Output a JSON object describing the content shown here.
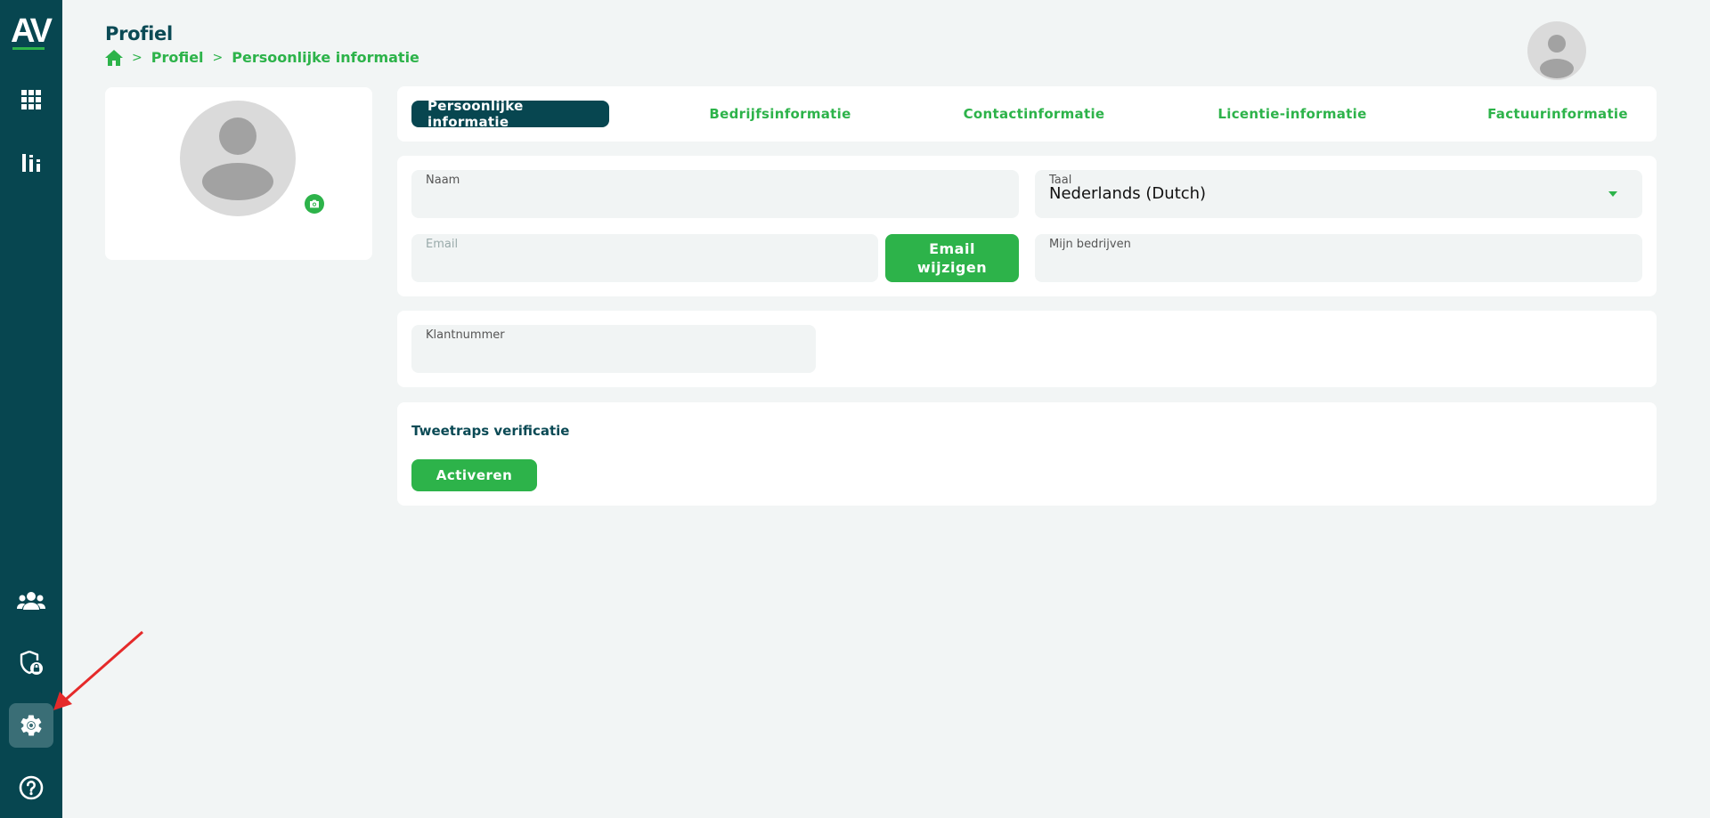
{
  "brand": {
    "logo_text": "AV",
    "accent": "#2db34a",
    "dark": "#074650"
  },
  "sidebar": {
    "items": [
      {
        "name": "apps-grid-icon"
      },
      {
        "name": "bar-chart-icon"
      },
      {
        "name": "users-group-icon"
      },
      {
        "name": "shield-lock-icon"
      },
      {
        "name": "gear-icon",
        "active": true
      },
      {
        "name": "help-icon"
      }
    ]
  },
  "header": {
    "title": "Profiel",
    "breadcrumb": {
      "separator": ">",
      "items": [
        "Profiel",
        "Persoonlijke informatie"
      ]
    }
  },
  "tabs": [
    {
      "label": "Persoonlijke informatie",
      "active": true
    },
    {
      "label": "Bedrijfsinformatie"
    },
    {
      "label": "Contactinformatie"
    },
    {
      "label": "Licentie-informatie"
    },
    {
      "label": "Factuurinformatie"
    }
  ],
  "form": {
    "name_label": "Naam",
    "name_value": "",
    "language_label": "Taal",
    "language_value": "Nederlands (Dutch)",
    "email_label": "Email",
    "email_value": "",
    "email_button": "Email wijzigen",
    "companies_label": "Mijn bedrijven",
    "companies_value": "",
    "customer_number_label": "Klantnummer",
    "customer_number_value": ""
  },
  "two_factor": {
    "title": "Tweetraps verificatie",
    "button": "Activeren"
  }
}
